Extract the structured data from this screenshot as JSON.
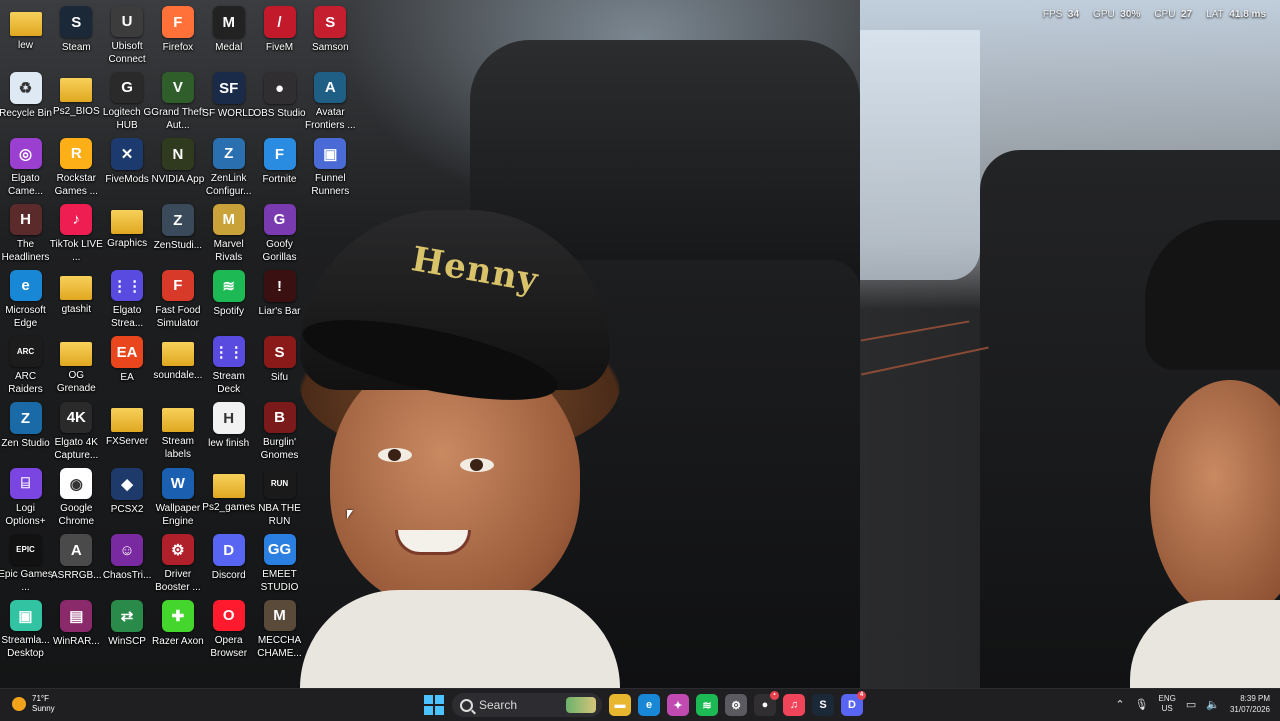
{
  "overlay": {
    "fps_label": "FPS",
    "fps_value": "34",
    "gpu_label": "GPU",
    "gpu_value": "30",
    "gpu_unit": "%",
    "cpu_label": "CPU",
    "cpu_value": "27",
    "lat_label": "LAT",
    "lat_value": "41.8",
    "lat_unit": "ms"
  },
  "wallpaper": {
    "cap_text": "Henny"
  },
  "desktop_icons": [
    {
      "label": "lew",
      "icon": "folder-icon",
      "color": "#e8b730",
      "glyph": "",
      "col": 0,
      "row": 0
    },
    {
      "label": "Steam",
      "icon": "steam-icon",
      "color": "#1b2838",
      "glyph": "S",
      "col": 1,
      "row": 0
    },
    {
      "label": "Ubisoft Connect",
      "icon": "ubisoft-icon",
      "color": "#3c3c3c",
      "glyph": "U",
      "col": 2,
      "row": 0
    },
    {
      "label": "Firefox",
      "icon": "firefox-icon",
      "color": "#ff7139",
      "glyph": "F",
      "col": 3,
      "row": 0
    },
    {
      "label": "Medal",
      "icon": "medal-icon",
      "color": "#222222",
      "glyph": "M",
      "col": 4,
      "row": 0
    },
    {
      "label": "FiveM",
      "icon": "fivem-icon",
      "color": "#c21a2b",
      "glyph": "/",
      "col": 5,
      "row": 0
    },
    {
      "label": "Samson",
      "icon": "samson-icon",
      "color": "#c41e2f",
      "glyph": "S",
      "col": 6,
      "row": 0
    },
    {
      "label": "Recycle Bin",
      "icon": "recycle-bin-icon",
      "color": "#dfe9f3",
      "glyph": "♻",
      "col": 0,
      "row": 1
    },
    {
      "label": "Ps2_BIOS",
      "icon": "folder-icon",
      "color": "#e8b730",
      "glyph": "",
      "col": 1,
      "row": 1
    },
    {
      "label": "Logitech G HUB",
      "icon": "logitech-icon",
      "color": "#2a2a2a",
      "glyph": "G",
      "col": 2,
      "row": 1
    },
    {
      "label": "Grand Theft Aut...",
      "icon": "gta-icon",
      "color": "#2f5e2a",
      "glyph": "V",
      "col": 3,
      "row": 1
    },
    {
      "label": "SF WORLD",
      "icon": "sf-world-icon",
      "color": "#1a2b4a",
      "glyph": "SF",
      "col": 4,
      "row": 1
    },
    {
      "label": "OBS Studio",
      "icon": "obs-icon",
      "color": "#302e31",
      "glyph": "●",
      "col": 5,
      "row": 1
    },
    {
      "label": "Avatar Frontiers ...",
      "icon": "avatar-icon",
      "color": "#1f5f86",
      "glyph": "A",
      "col": 6,
      "row": 1
    },
    {
      "label": "Elgato Came...",
      "icon": "elgato-camera-icon",
      "color": "#9a3fd0",
      "glyph": "◎",
      "col": 0,
      "row": 2
    },
    {
      "label": "Rockstar Games ...",
      "icon": "rockstar-icon",
      "color": "#fcaf17",
      "glyph": "R",
      "col": 1,
      "row": 2
    },
    {
      "label": "FiveMods",
      "icon": "fivemods-icon",
      "color": "#1d3a6e",
      "glyph": "✕",
      "col": 2,
      "row": 2
    },
    {
      "label": "NVIDIA App",
      "icon": "nvidia-icon",
      "color": "#2f3a1f",
      "glyph": "N",
      "col": 3,
      "row": 2
    },
    {
      "label": "ZenLink Configur...",
      "icon": "zenlink-icon",
      "color": "#2a6fb0",
      "glyph": "Z",
      "col": 4,
      "row": 2
    },
    {
      "label": "Fortnite",
      "icon": "fortnite-icon",
      "color": "#2a8ce0",
      "glyph": "F",
      "col": 5,
      "row": 2
    },
    {
      "label": "Funnel Runners",
      "icon": "funnel-runners-icon",
      "color": "#4a6bd6",
      "glyph": "▣",
      "col": 6,
      "row": 2
    },
    {
      "label": "The Headliners ...",
      "icon": "headliners-icon",
      "color": "#5b2a2a",
      "glyph": "H",
      "col": 0,
      "row": 3
    },
    {
      "label": "TikTok LIVE ...",
      "icon": "tiktok-icon",
      "color": "#ee1d52",
      "glyph": "♪",
      "col": 1,
      "row": 3
    },
    {
      "label": "Graphics",
      "icon": "folder-icon",
      "color": "#e8b730",
      "glyph": "",
      "col": 2,
      "row": 3
    },
    {
      "label": "ZenStudi...",
      "icon": "zen-studio-icon",
      "color": "#3b4a5a",
      "glyph": "Z",
      "col": 3,
      "row": 3
    },
    {
      "label": "Marvel Rivals",
      "icon": "marvel-rivals-icon",
      "color": "#caa23a",
      "glyph": "M",
      "col": 4,
      "row": 3
    },
    {
      "label": "Goofy Gorillas",
      "icon": "goofy-gorillas-icon",
      "color": "#7a3ab0",
      "glyph": "G",
      "col": 5,
      "row": 3
    },
    {
      "label": "Microsoft Edge",
      "icon": "edge-icon",
      "color": "#1787d6",
      "glyph": "e",
      "col": 0,
      "row": 4
    },
    {
      "label": "gtashit",
      "icon": "folder-icon",
      "color": "#e8b730",
      "glyph": "",
      "col": 1,
      "row": 4
    },
    {
      "label": "Elgato Strea...",
      "icon": "elgato-stream-icon",
      "color": "#5a4be0",
      "glyph": "⋮⋮",
      "col": 2,
      "row": 4
    },
    {
      "label": "Fast Food Simulator",
      "icon": "fast-food-icon",
      "color": "#d83a2a",
      "glyph": "F",
      "col": 3,
      "row": 4
    },
    {
      "label": "Spotify",
      "icon": "spotify-icon",
      "color": "#1db954",
      "glyph": "≋",
      "col": 4,
      "row": 4
    },
    {
      "label": "Liar's Bar",
      "icon": "liars-bar-icon",
      "color": "#3a1010",
      "glyph": "!",
      "col": 5,
      "row": 4
    },
    {
      "label": "ARC Raiders",
      "icon": "arc-raiders-icon",
      "color": "#1c1c1c",
      "glyph": "ARC",
      "col": 0,
      "row": 5
    },
    {
      "label": "OG Grenade",
      "icon": "folder-icon",
      "color": "#e8b730",
      "glyph": "",
      "col": 1,
      "row": 5
    },
    {
      "label": "EA",
      "icon": "ea-icon",
      "color": "#e9461e",
      "glyph": "EA",
      "col": 2,
      "row": 5
    },
    {
      "label": "soundale...",
      "icon": "folder-icon",
      "color": "#e8b730",
      "glyph": "",
      "col": 3,
      "row": 5
    },
    {
      "label": "Stream Deck",
      "icon": "stream-deck-icon",
      "color": "#5a4be0",
      "glyph": "⋮⋮",
      "col": 4,
      "row": 5
    },
    {
      "label": "Sifu",
      "icon": "sifu-icon",
      "color": "#8a1a1a",
      "glyph": "S",
      "col": 5,
      "row": 5
    },
    {
      "label": "Zen Studio",
      "icon": "zen-studio-icon",
      "color": "#1a6aa8",
      "glyph": "Z",
      "col": 0,
      "row": 6
    },
    {
      "label": "Elgato 4K Capture...",
      "icon": "elgato-4k-icon",
      "color": "#2a2a2a",
      "glyph": "4K",
      "col": 1,
      "row": 6
    },
    {
      "label": "FXServer",
      "icon": "folder-icon",
      "color": "#e8b730",
      "glyph": "",
      "col": 2,
      "row": 6
    },
    {
      "label": "Stream labels",
      "icon": "folder-icon",
      "color": "#e8b730",
      "glyph": "",
      "col": 3,
      "row": 6
    },
    {
      "label": "lew finish",
      "icon": "document-icon",
      "color": "#f2f2f2",
      "glyph": "H",
      "col": 4,
      "row": 6
    },
    {
      "label": "Burglin' Gnomes",
      "icon": "burglin-gnomes-icon",
      "color": "#7a1a1a",
      "glyph": "B",
      "col": 5,
      "row": 6
    },
    {
      "label": "Logi Options+",
      "icon": "logi-options-icon",
      "color": "#7a45e0",
      "glyph": "⌸",
      "col": 0,
      "row": 7
    },
    {
      "label": "Google Chrome",
      "icon": "chrome-icon",
      "color": "#ffffff",
      "glyph": "◉",
      "col": 1,
      "row": 7
    },
    {
      "label": "PCSX2",
      "icon": "pcsx2-icon",
      "color": "#1e3a6a",
      "glyph": "◆",
      "col": 2,
      "row": 7
    },
    {
      "label": "Wallpaper Engine",
      "icon": "wallpaper-engine-icon",
      "color": "#1a5fb0",
      "glyph": "W",
      "col": 3,
      "row": 7
    },
    {
      "label": "Ps2_games",
      "icon": "folder-icon",
      "color": "#e8b730",
      "glyph": "",
      "col": 4,
      "row": 7
    },
    {
      "label": "NBA THE RUN",
      "icon": "nba-the-run-icon",
      "color": "#1a1a1a",
      "glyph": "RUN",
      "col": 5,
      "row": 7
    },
    {
      "label": "Epic Games ...",
      "icon": "epic-games-icon",
      "color": "#121212",
      "glyph": "EPIC",
      "col": 0,
      "row": 8
    },
    {
      "label": "ASRRGB...",
      "icon": "asrrgb-icon",
      "color": "#4a4a4a",
      "glyph": "A",
      "col": 1,
      "row": 8
    },
    {
      "label": "ChaosTri...",
      "icon": "chaostricks-icon",
      "color": "#7a2aa0",
      "glyph": "☺",
      "col": 2,
      "row": 8
    },
    {
      "label": "Driver Booster ...",
      "icon": "driver-booster-icon",
      "color": "#b0202a",
      "glyph": "⚙",
      "col": 3,
      "row": 8
    },
    {
      "label": "Discord",
      "icon": "discord-icon",
      "color": "#5865f2",
      "glyph": "D",
      "col": 4,
      "row": 8
    },
    {
      "label": "EMEET STUDIO",
      "icon": "emeet-icon",
      "color": "#2a7fe0",
      "glyph": "GG",
      "col": 5,
      "row": 8
    },
    {
      "label": "Streamla... Desktop",
      "icon": "streamlabs-icon",
      "color": "#31c3a2",
      "glyph": "▣",
      "col": 0,
      "row": 9
    },
    {
      "label": "WinRAR...",
      "icon": "winrar-icon",
      "color": "#8a2a6a",
      "glyph": "▤",
      "col": 1,
      "row": 9
    },
    {
      "label": "WinSCP",
      "icon": "winscp-icon",
      "color": "#2a8a4a",
      "glyph": "⇄",
      "col": 2,
      "row": 9
    },
    {
      "label": "Razer Axon",
      "icon": "razer-axon-icon",
      "color": "#44d62c",
      "glyph": "✚",
      "col": 3,
      "row": 9
    },
    {
      "label": "Opera Browser",
      "icon": "opera-icon",
      "color": "#ff1b2d",
      "glyph": "O",
      "col": 4,
      "row": 9
    },
    {
      "label": "MECCHA CHAME...",
      "icon": "meccha-icon",
      "color": "#5a4a3a",
      "glyph": "M",
      "col": 5,
      "row": 9
    }
  ],
  "taskbar": {
    "weather": {
      "temp": "71°F",
      "condition": "Sunny",
      "icon": "sun-icon"
    },
    "search_placeholder": "Search",
    "apps": [
      {
        "name": "file-explorer-icon",
        "color": "#e8b730",
        "glyph": "▬",
        "badge": ""
      },
      {
        "name": "edge-taskbar-icon",
        "color": "#1787d6",
        "glyph": "e",
        "badge": ""
      },
      {
        "name": "copilot-taskbar-icon",
        "color": "#c04ab0",
        "glyph": "✦",
        "badge": ""
      },
      {
        "name": "spotify-taskbar-icon",
        "color": "#1db954",
        "glyph": "≋",
        "badge": ""
      },
      {
        "name": "settings-taskbar-icon",
        "color": "#5a5a60",
        "glyph": "⚙",
        "badge": ""
      },
      {
        "name": "obs-taskbar-icon",
        "color": "#302e31",
        "glyph": "●",
        "badge": "•"
      },
      {
        "name": "itunes-taskbar-icon",
        "color": "#f0445a",
        "glyph": "♫",
        "badge": ""
      },
      {
        "name": "steam-taskbar-icon",
        "color": "#1b2838",
        "glyph": "S",
        "badge": ""
      },
      {
        "name": "discord-taskbar-icon",
        "color": "#5865f2",
        "glyph": "D",
        "badge": "4"
      }
    ],
    "tray": {
      "lang_top": "ENG",
      "lang_bottom": "US",
      "time": "8:39 PM",
      "date": "31/07/2026"
    }
  }
}
